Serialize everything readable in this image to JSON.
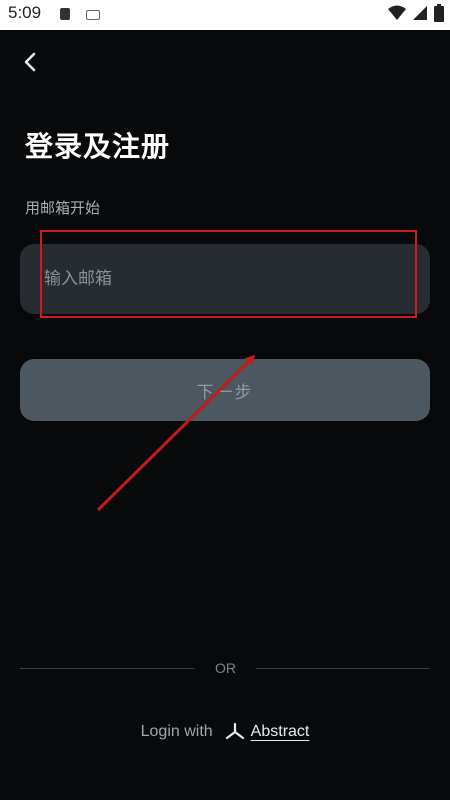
{
  "status_bar": {
    "time": "5:09"
  },
  "header": {
    "back_icon": "chevron-left-icon"
  },
  "main": {
    "title": "登录及注册",
    "subtitle": "用邮箱开始",
    "email_placeholder": "输入邮箱",
    "email_value": "",
    "next_label": "下一步"
  },
  "divider": {
    "label": "OR"
  },
  "footer": {
    "login_with": "Login with",
    "provider_label": "Abstract",
    "provider_icon": "abstract-logo-icon"
  },
  "colors": {
    "background": "#08090b",
    "input_bg": "#272c32",
    "button_bg": "#4c575f",
    "annotation_red": "#d11a1a"
  }
}
